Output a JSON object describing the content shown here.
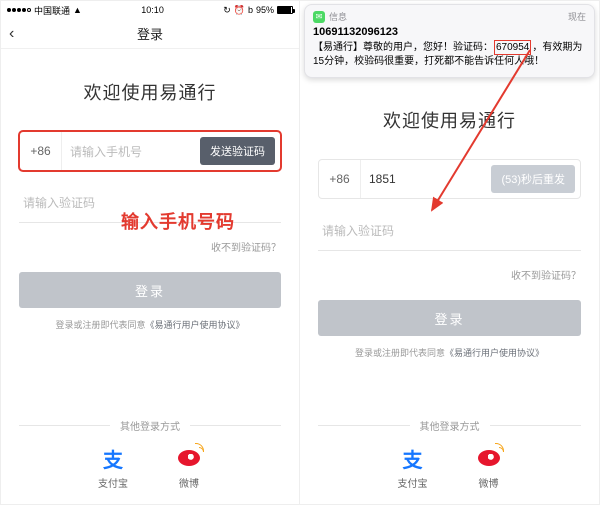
{
  "status": {
    "carrier": "中国联通",
    "time": "10:10",
    "battery_pct": "95%"
  },
  "nav": {
    "title": "登录"
  },
  "welcome": "欢迎使用易通行",
  "phone": {
    "country_code": "+86",
    "placeholder": "请输入手机号",
    "filled_value": "1851",
    "send_label": "发送验证码",
    "resend_label": "(53)秒后重发"
  },
  "code": {
    "placeholder": "请输入验证码"
  },
  "links": {
    "cant_get": "收不到验证码？",
    "login": "登录",
    "agree_prefix": "登录或注册即代表同意",
    "agree_link": "《易通行用户使用协议》"
  },
  "other": {
    "title": "其他登录方式",
    "alipay": "支付宝",
    "weibo": "微博"
  },
  "annotation": {
    "input_hint": "输入手机号码"
  },
  "notification": {
    "app": "信息",
    "time": "现在",
    "sender": "10691132096123",
    "body_pre": "【易通行】尊敬的用户，您好！验证码：",
    "code": "670954",
    "body_post": "，有效期为15分钟，校验码很重要，打死都不能告诉任何人哦！"
  }
}
